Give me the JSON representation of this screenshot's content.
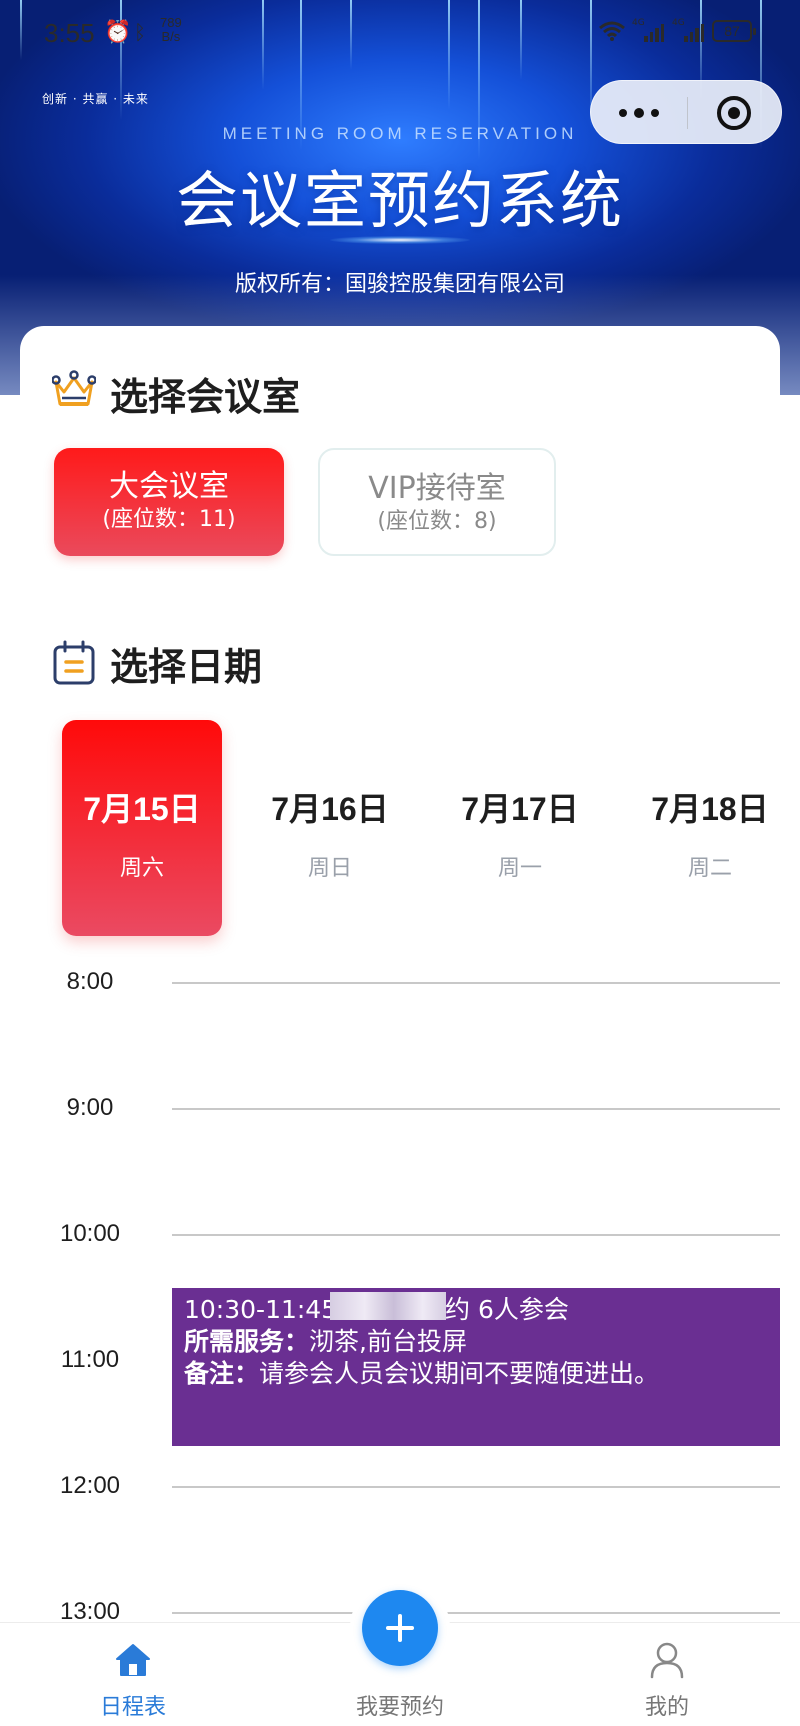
{
  "status_bar": {
    "time": "3:55",
    "net_speed_value": "789",
    "net_speed_unit": "B/s",
    "battery": "87",
    "network_type": "4G"
  },
  "header": {
    "slogan": "创新 · 共赢 · 未来",
    "subtitle_en": "MEETING ROOM RESERVATION",
    "title": "会议室预约系统",
    "copyright": "版权所有：国骏控股集团有限公司"
  },
  "room_section": {
    "title": "选择会议室",
    "rooms": [
      {
        "name": "大会议室",
        "seats": "(座位数：11)"
      },
      {
        "name": "VIP接待室",
        "seats": "(座位数：8)"
      }
    ],
    "selected_index": 0
  },
  "date_section": {
    "title": "选择日期",
    "dates": [
      {
        "date": "7月15日",
        "weekday": "周六"
      },
      {
        "date": "7月16日",
        "weekday": "周日"
      },
      {
        "date": "7月17日",
        "weekday": "周一"
      },
      {
        "date": "7月18日",
        "weekday": "周二"
      }
    ],
    "selected_index": 0
  },
  "schedule": {
    "hours": [
      "8:00",
      "9:00",
      "10:00",
      "11:00",
      "12:00",
      "13:00"
    ],
    "events": [
      {
        "summary": "10:30-11:45 　　　　约 6人参会",
        "services_label": "所需服务：",
        "services": "沏茶,前台投屏",
        "remark_label": "备注：",
        "remark": "请参会人员会议期间不要随便进出。",
        "color": "#6a2f92"
      }
    ]
  },
  "tab_bar": {
    "tabs": [
      {
        "label": "日程表",
        "icon": "home-icon"
      },
      {
        "label": "我要预约",
        "icon": "plus-icon"
      },
      {
        "label": "我的",
        "icon": "user-icon"
      }
    ],
    "active_index": 0,
    "accent_color": "#2a7bd8"
  },
  "colors": {
    "primary_red": "#ff1a1a",
    "fab_blue": "#1e88f0",
    "banner_blue": "#1450d8"
  }
}
